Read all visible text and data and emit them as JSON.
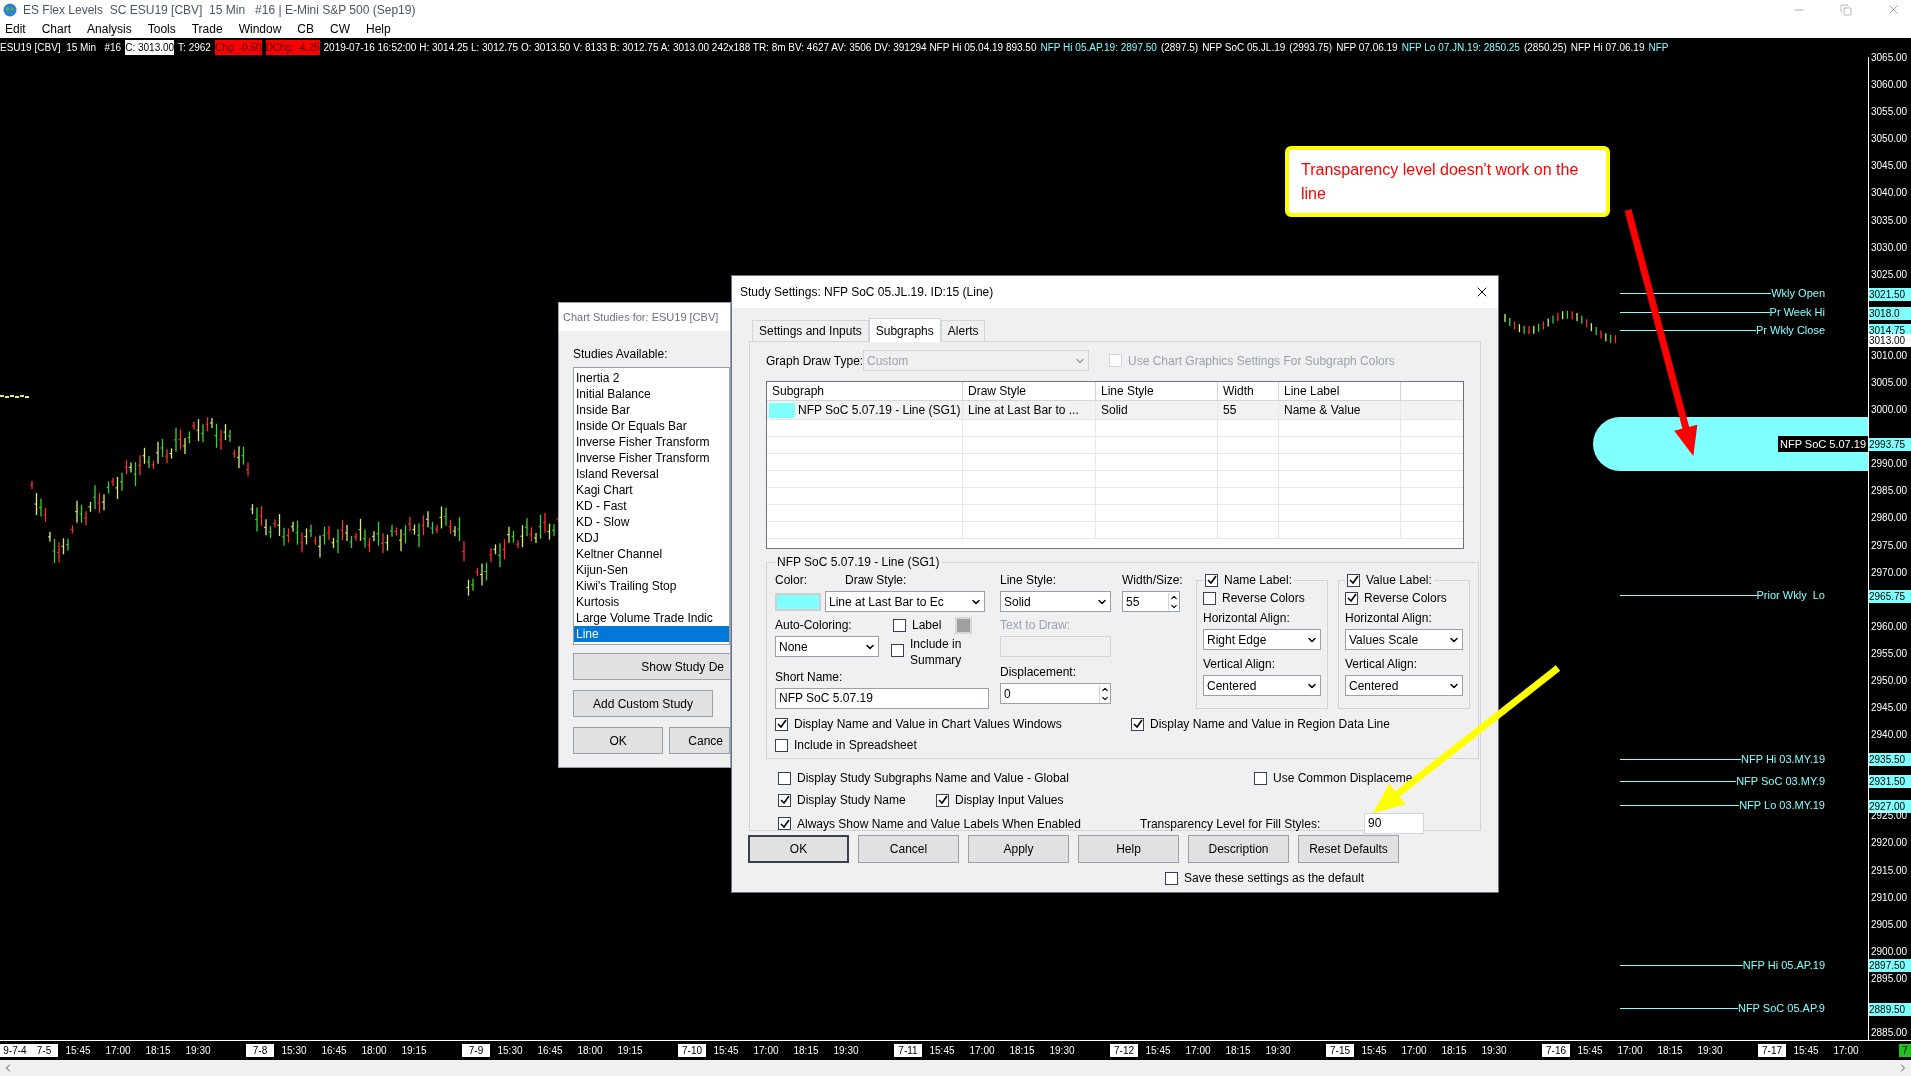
{
  "window": {
    "title": "ES Flex Levels  SC ESU19 [CBV]  15 Min   #16 | E-Mini S&P 500 (Sep19)"
  },
  "menu": [
    "Edit",
    "Chart",
    "Analysis",
    "Tools",
    "Trade",
    "Window",
    "CB",
    "CW",
    "Help"
  ],
  "data_line": [
    {
      "text": "ESU19 [CBV]  15 Min   #16",
      "kind": "plain"
    },
    {
      "text": "C: 3013.00",
      "kind": "white"
    },
    {
      "text": "T: 2962",
      "kind": "plain"
    },
    {
      "text": "Chg: -0.50",
      "kind": "red"
    },
    {
      "text": "DChg: -4.25",
      "kind": "red"
    },
    {
      "text": "2019-07-16 16:52:00 H: 3014.25 L: 3012.75 O: 3013.50 V: 8133 B: 3012.75 A: 3013.00 242x188 TR: 8m BV: 4627 AV: 3506 DV: 391294 NFP Hi 05.04.19 893.50",
      "kind": "plain"
    },
    {
      "text": "NFP Hi 05.AP.19: 2897.50",
      "kind": "cyan"
    },
    {
      "text": "(2897.5)",
      "kind": "plain"
    },
    {
      "text": "NFP SoC 05.JL.19",
      "kind": "plain"
    },
    {
      "text": "(2993.75)",
      "kind": "plain"
    },
    {
      "text": "NFP 07.06.19",
      "kind": "plain"
    },
    {
      "text": "NFP Lo 07.JN.19: 2850.25",
      "kind": "cyan"
    },
    {
      "text": "(2850.25)",
      "kind": "plain"
    },
    {
      "text": "NFP Hi 07.06.19",
      "kind": "plain"
    },
    {
      "text": "NFP",
      "kind": "cyan"
    }
  ],
  "price_axis": {
    "ticks": [
      "3065.00",
      "3060.00",
      "3055.00",
      "3050.00",
      "3045.00",
      "3040.00",
      "3035.00",
      "3030.00",
      "3025.00",
      "3010.00",
      "3005.00",
      "3000.00",
      "2990.00",
      "2985.00",
      "2980.00",
      "2975.00",
      "2970.00",
      "2960.00",
      "2955.00",
      "2950.00",
      "2945.00",
      "2940.00",
      "2925.00",
      "2920.00",
      "2915.00",
      "2910.00",
      "2905.00",
      "2900.00",
      "2895.00",
      "2885.00"
    ]
  },
  "levels": [
    {
      "label": "Wkly Open",
      "value": "3021.50",
      "kind": "line"
    },
    {
      "label": "Pr Week Hi",
      "value": "3018.0",
      "kind": "line"
    },
    {
      "label": "Pr Wkly Close",
      "value": "3014.75",
      "kind": "line"
    },
    {
      "value": "3013.00",
      "kind": "last"
    },
    {
      "label": "NFP SoC 5.07.19",
      "value": "2993.75",
      "kind": "band"
    },
    {
      "label": "Prior Wkly  Lo",
      "value": "2965.75",
      "kind": "line"
    },
    {
      "label": "NFP Hi 03.MY.19",
      "value": "2935.50",
      "kind": "line"
    },
    {
      "label": "NFP SoC 03.MY.9",
      "value": "2931.50",
      "kind": "line"
    },
    {
      "label": "NFP Lo 03.MY.19",
      "value": "2927.00",
      "kind": "line"
    },
    {
      "label": "NFP Hi 05.AP.19",
      "value": "2897.50",
      "kind": "line"
    },
    {
      "label": "NFP SoC 05.AP.9",
      "value": "2889.50",
      "kind": "line"
    }
  ],
  "time_axis": [
    {
      "text": "9-7-4",
      "kind": "date"
    },
    {
      "text": "7-5",
      "kind": "date"
    },
    {
      "text": "15:45",
      "kind": "time"
    },
    {
      "text": "17:00",
      "kind": "time"
    },
    {
      "text": "18:15",
      "kind": "time"
    },
    {
      "text": "19:30",
      "kind": "time"
    },
    {
      "text": "7-8",
      "kind": "date"
    },
    {
      "text": "15:30",
      "kind": "time"
    },
    {
      "text": "16:45",
      "kind": "time"
    },
    {
      "text": "18:00",
      "kind": "time"
    },
    {
      "text": "19:15",
      "kind": "time"
    },
    {
      "text": "7-9",
      "kind": "date"
    },
    {
      "text": "15:30",
      "kind": "time"
    },
    {
      "text": "16:45",
      "kind": "time"
    },
    {
      "text": "18:00",
      "kind": "time"
    },
    {
      "text": "19:15",
      "kind": "time"
    },
    {
      "text": "7-10",
      "kind": "date"
    },
    {
      "text": "15:45",
      "kind": "time"
    },
    {
      "text": "17:00",
      "kind": "time"
    },
    {
      "text": "18:15",
      "kind": "time"
    },
    {
      "text": "19:30",
      "kind": "time"
    },
    {
      "text": "7-11",
      "kind": "date"
    },
    {
      "text": "15:45",
      "kind": "time"
    },
    {
      "text": "17:00",
      "kind": "time"
    },
    {
      "text": "18:15",
      "kind": "time"
    },
    {
      "text": "19:30",
      "kind": "time"
    },
    {
      "text": "7-12",
      "kind": "date"
    },
    {
      "text": "15:45",
      "kind": "time"
    },
    {
      "text": "17:00",
      "kind": "time"
    },
    {
      "text": "18:15",
      "kind": "time"
    },
    {
      "text": "19:30",
      "kind": "time"
    },
    {
      "text": "7-15",
      "kind": "date"
    },
    {
      "text": "15:45",
      "kind": "time"
    },
    {
      "text": "17:00",
      "kind": "time"
    },
    {
      "text": "18:15",
      "kind": "time"
    },
    {
      "text": "19:30",
      "kind": "time"
    },
    {
      "text": "7-16",
      "kind": "date"
    },
    {
      "text": "15:45",
      "kind": "time"
    },
    {
      "text": "17:00",
      "kind": "time"
    },
    {
      "text": "18:15",
      "kind": "time"
    },
    {
      "text": "19:30",
      "kind": "time"
    },
    {
      "text": "7-17",
      "kind": "date"
    },
    {
      "text": "15:45",
      "kind": "time"
    },
    {
      "text": "17:00",
      "kind": "time"
    },
    {
      "text": "7",
      "kind": "current"
    }
  ],
  "callout": {
    "text": "Transparency level doesn't work on the line"
  },
  "chart_studies": {
    "title": "Chart Studies for: ESU19 [CBV]",
    "list_label": "Studies Available:",
    "items": [
      {
        "label": "Inertia 2",
        "selected": false
      },
      {
        "label": "Initial Balance",
        "selected": false
      },
      {
        "label": "Inside Bar",
        "selected": false
      },
      {
        "label": "Inside Or Equals Bar",
        "selected": false
      },
      {
        "label": "Inverse Fisher Transform",
        "selected": false
      },
      {
        "label": "Inverse Fisher Transform",
        "selected": false
      },
      {
        "label": "Island Reversal",
        "selected": false
      },
      {
        "label": "Kagi Chart",
        "selected": false
      },
      {
        "label": "KD - Fast",
        "selected": false
      },
      {
        "label": "KD - Slow",
        "selected": false
      },
      {
        "label": "KDJ",
        "selected": false
      },
      {
        "label": "Keltner Channel",
        "selected": false
      },
      {
        "label": "Kijun-Sen",
        "selected": false
      },
      {
        "label": "Kiwi's Trailing Stop",
        "selected": false
      },
      {
        "label": "Kurtosis",
        "selected": false
      },
      {
        "label": "Large Volume Trade Indic",
        "selected": false
      },
      {
        "label": "Line",
        "selected": true
      }
    ],
    "buttons": [
      "Show Study De",
      "Add Custom Study",
      "OK",
      "Cance"
    ]
  },
  "study_settings": {
    "title": "Study Settings: NFP SoC 05.JL.19. ID:15 (Line)",
    "tabs": [
      {
        "label": "Settings and Inputs",
        "selected": false
      },
      {
        "label": "Subgraphs",
        "selected": true
      },
      {
        "label": "Alerts",
        "selected": false
      }
    ],
    "graph_draw_type": {
      "label": "Graph Draw Type:",
      "value": "Custom",
      "disabled": true
    },
    "use_chart_graphics": {
      "label": "Use Chart Graphics Settings For Subgraph Colors",
      "checked": false,
      "disabled": true
    },
    "table": {
      "columns": [
        "Subgraph",
        "Draw Style",
        "Line Style",
        "Width",
        "Line Label"
      ],
      "rows": [
        {
          "color": "#80ffff",
          "cells": [
            "NFP SoC 5.07.19 - Line (SG1)",
            "Line at Last Bar to ...",
            "Solid",
            "55",
            "Name & Value"
          ]
        }
      ]
    },
    "group": {
      "title": "NFP SoC 5.07.19 - Line (SG1)",
      "color_label": "Color:",
      "color": "#80ffff",
      "draw_style": {
        "label": "Draw Style:",
        "value": "Line at Last Bar to Ec"
      },
      "auto_coloring": {
        "label": "Auto-Coloring:",
        "value": "None"
      },
      "label_check": {
        "label": "Label",
        "checked": false
      },
      "include_summary": {
        "label": "Include in Summary",
        "checked": false
      },
      "short_name": {
        "label": "Short Name:",
        "value": "NFP SoC 5.07.19"
      },
      "line_style": {
        "label": "Line Style:",
        "value": "Solid"
      },
      "text_to_draw": {
        "label": "Text to Draw:",
        "disabled": true
      },
      "displacement": {
        "label": "Displacement:",
        "value": "0"
      },
      "width": {
        "label": "Width/Size:",
        "value": "55"
      },
      "name_label": {
        "label": "Name Label:",
        "checked": true,
        "reverse_label": "Reverse Colors",
        "reverse": false,
        "h_label": "Horizontal Align:",
        "h_value": "Right Edge",
        "v_label": "Vertical Align:",
        "v_value": "Centered"
      },
      "value_label": {
        "label": "Value Label:",
        "checked": true,
        "reverse_label": "Reverse Colors",
        "reverse": true,
        "h_label": "Horizontal Align:",
        "h_value": "Values Scale",
        "v_label": "Vertical Align:",
        "v_value": "Centered"
      },
      "checks": [
        {
          "label": "Display Name and Value in Chart Values Windows",
          "checked": true
        },
        {
          "label": "Display Name and Value in Region Data Line",
          "checked": true
        },
        {
          "label": "Include in Spreadsheet",
          "checked": false
        }
      ]
    },
    "options": [
      {
        "label": "Display Study Subgraphs Name and Value - Global",
        "checked": false
      },
      {
        "label": "Use Common Displaceme",
        "checked": false
      },
      {
        "label": "Display Study Name",
        "checked": true
      },
      {
        "label": "Display Input Values",
        "checked": true
      },
      {
        "label": "Always Show Name and Value Labels When Enabled",
        "checked": true
      }
    ],
    "transparency": {
      "label": "Transparency Level for Fill Styles:",
      "value": "90"
    },
    "buttons": [
      "OK",
      "Cancel",
      "Apply",
      "Help",
      "Description",
      "Reset Defaults"
    ],
    "save_default": {
      "label": "Save these settings as the default",
      "checked": false
    }
  }
}
